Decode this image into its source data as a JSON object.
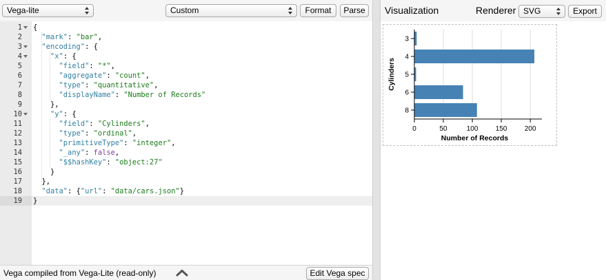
{
  "left_toolbar": {
    "mode_select": "Vega-lite",
    "example_select": "Custom",
    "format_label": "Format",
    "parse_label": "Parse"
  },
  "editor": {
    "line_numbers": [
      "1",
      "2",
      "3",
      "4",
      "5",
      "6",
      "7",
      "8",
      "9",
      "10",
      "11",
      "12",
      "13",
      "14",
      "15",
      "16",
      "17",
      "18",
      "19"
    ],
    "fold_lines": [
      "1",
      "3",
      "4",
      "10"
    ],
    "active_line": "19",
    "lines": [
      [
        [
          "p",
          "{"
        ]
      ],
      [
        [
          "p",
          "  "
        ],
        [
          "k",
          "\"mark\""
        ],
        [
          "p",
          ": "
        ],
        [
          "s",
          "\"bar\""
        ],
        [
          "p",
          ","
        ]
      ],
      [
        [
          "p",
          "  "
        ],
        [
          "k",
          "\"encoding\""
        ],
        [
          "p",
          ": {"
        ]
      ],
      [
        [
          "p",
          "    "
        ],
        [
          "k",
          "\"x\""
        ],
        [
          "p",
          ": {"
        ]
      ],
      [
        [
          "p",
          "      "
        ],
        [
          "k",
          "\"field\""
        ],
        [
          "p",
          ": "
        ],
        [
          "s",
          "\"*\""
        ],
        [
          "p",
          ","
        ]
      ],
      [
        [
          "p",
          "      "
        ],
        [
          "k",
          "\"aggregate\""
        ],
        [
          "p",
          ": "
        ],
        [
          "s",
          "\"count\""
        ],
        [
          "p",
          ","
        ]
      ],
      [
        [
          "p",
          "      "
        ],
        [
          "k",
          "\"type\""
        ],
        [
          "p",
          ": "
        ],
        [
          "s",
          "\"quantitative\""
        ],
        [
          "p",
          ","
        ]
      ],
      [
        [
          "p",
          "      "
        ],
        [
          "k",
          "\"displayName\""
        ],
        [
          "p",
          ": "
        ],
        [
          "s",
          "\"Number of Records\""
        ]
      ],
      [
        [
          "p",
          "    },"
        ]
      ],
      [
        [
          "p",
          "    "
        ],
        [
          "k",
          "\"y\""
        ],
        [
          "p",
          ": {"
        ]
      ],
      [
        [
          "p",
          "      "
        ],
        [
          "k",
          "\"field\""
        ],
        [
          "p",
          ": "
        ],
        [
          "s",
          "\"Cylinders\""
        ],
        [
          "p",
          ","
        ]
      ],
      [
        [
          "p",
          "      "
        ],
        [
          "k",
          "\"type\""
        ],
        [
          "p",
          ": "
        ],
        [
          "s",
          "\"ordinal\""
        ],
        [
          "p",
          ","
        ]
      ],
      [
        [
          "p",
          "      "
        ],
        [
          "k",
          "\"primitiveType\""
        ],
        [
          "p",
          ": "
        ],
        [
          "s",
          "\"integer\""
        ],
        [
          "p",
          ","
        ]
      ],
      [
        [
          "p",
          "      "
        ],
        [
          "k",
          "\"_any\""
        ],
        [
          "p",
          ": "
        ],
        [
          "b",
          "false"
        ],
        [
          "p",
          ","
        ]
      ],
      [
        [
          "p",
          "      "
        ],
        [
          "k",
          "\"$$hashKey\""
        ],
        [
          "p",
          ": "
        ],
        [
          "s",
          "\"object:27\""
        ]
      ],
      [
        [
          "p",
          "    }"
        ]
      ],
      [
        [
          "p",
          "  },"
        ]
      ],
      [
        [
          "p",
          "  "
        ],
        [
          "k",
          "\"data\""
        ],
        [
          "p",
          ": {"
        ],
        [
          "k",
          "\"url\""
        ],
        [
          "p",
          ": "
        ],
        [
          "s",
          "\"data/cars.json\""
        ],
        [
          "p",
          "}"
        ]
      ],
      [
        [
          "p",
          "}"
        ]
      ]
    ]
  },
  "bottom_bar": {
    "label": "Vega compiled from Vega-Lite (read-only)",
    "edit_vega_label": "Edit Vega spec"
  },
  "right_toolbar": {
    "title": "Visualization",
    "renderer_label": "Renderer",
    "renderer_select": "SVG",
    "export_label": "Export"
  },
  "colors": {
    "bar": "#4682b4",
    "key": "#2f7fa1",
    "string": "#1a7a1a",
    "boolean": "#7a3ea1"
  },
  "chart_data": {
    "type": "bar",
    "orientation": "horizontal",
    "categories": [
      "3",
      "4",
      "5",
      "6",
      "8"
    ],
    "values": [
      4,
      207,
      3,
      84,
      108
    ],
    "xlabel": "Number of Records",
    "ylabel": "Cylinders",
    "x_ticks": [
      "0",
      "50",
      "100",
      "150",
      "200"
    ],
    "xlim": [
      0,
      220
    ],
    "grid": true
  }
}
